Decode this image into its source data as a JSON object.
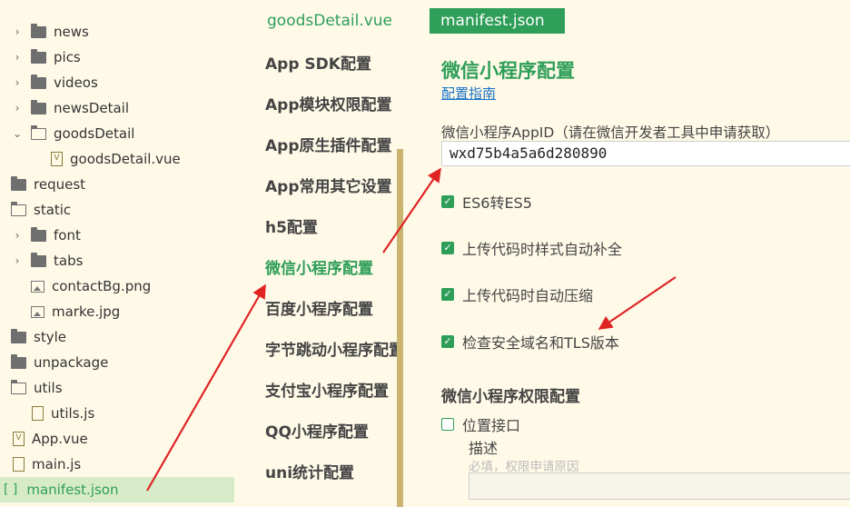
{
  "tree": [
    {
      "label": "news",
      "kind": "folder",
      "expanded": false
    },
    {
      "label": "pics",
      "kind": "folder",
      "expanded": false
    },
    {
      "label": "videos",
      "kind": "folder",
      "expanded": false
    },
    {
      "label": "newsDetail",
      "kind": "folder",
      "expanded": false
    },
    {
      "label": "goodsDetail",
      "kind": "folder-open",
      "expanded": true
    },
    {
      "label": "goodsDetail.vue",
      "kind": "vue"
    },
    {
      "label": "request",
      "kind": "folder"
    },
    {
      "label": "static",
      "kind": "folder-open",
      "expanded": true
    },
    {
      "label": "font",
      "kind": "folder",
      "expanded": false
    },
    {
      "label": "tabs",
      "kind": "folder",
      "expanded": false
    },
    {
      "label": "contactBg.png",
      "kind": "image"
    },
    {
      "label": "marke.jpg",
      "kind": "image"
    },
    {
      "label": "style",
      "kind": "folder"
    },
    {
      "label": "unpackage",
      "kind": "folder"
    },
    {
      "label": "utils",
      "kind": "folder-open",
      "expanded": true
    },
    {
      "label": "utils.js",
      "kind": "js"
    },
    {
      "label": "App.vue",
      "kind": "vue"
    },
    {
      "label": "main.js",
      "kind": "js"
    },
    {
      "label": "manifest.json",
      "kind": "json"
    }
  ],
  "tabs": {
    "goods": "goodsDetail.vue",
    "manifest": "manifest.json"
  },
  "nav": [
    "App SDK配置",
    "App模块权限配置",
    "App原生插件配置",
    "App常用其它设置",
    "h5配置",
    "微信小程序配置",
    "百度小程序配置",
    "字节跳动小程序配置",
    "支付宝小程序配置",
    "QQ小程序配置",
    "uni统计配置"
  ],
  "main": {
    "title": "微信小程序配置",
    "guide_link": "配置指南",
    "appid_label": "微信小程序AppID（请在微信开发者工具中申请获取）",
    "appid_value": "wxd75b4a5a6d280890",
    "checks": [
      {
        "label": "ES6转ES5",
        "checked": true
      },
      {
        "label": "上传代码时样式自动补全",
        "checked": true
      },
      {
        "label": "上传代码时自动压缩",
        "checked": true
      },
      {
        "label": "检查安全域名和TLS版本",
        "checked": true
      }
    ],
    "perm_title": "微信小程序权限配置",
    "location_label": "位置接口",
    "location_checked": false,
    "desc_label": "描述",
    "desc_hint": "必填，权限申请原因"
  },
  "colors": {
    "accent": "#2e9e58",
    "background": "#fffae8",
    "arrow": "#e02424",
    "link": "#1a73c6"
  }
}
